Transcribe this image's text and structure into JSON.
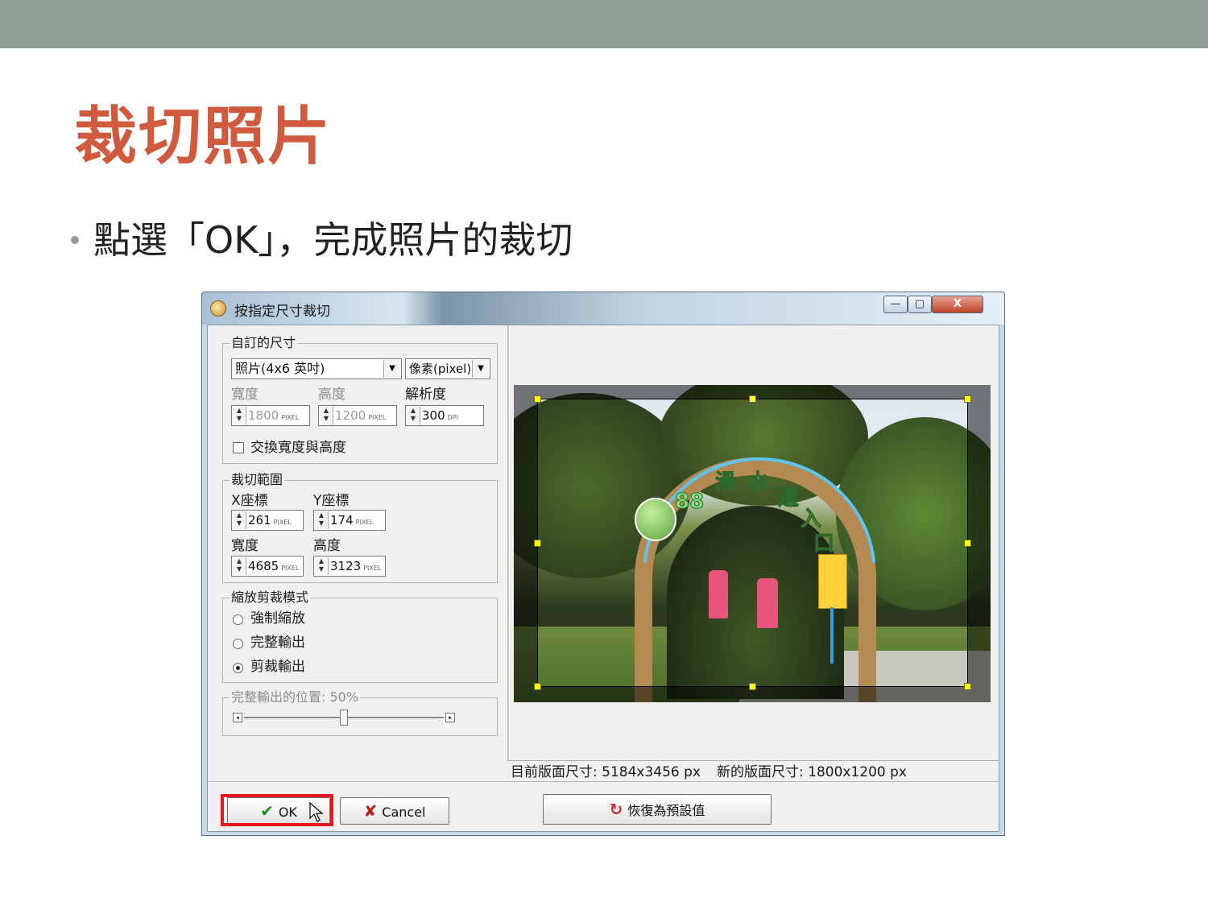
{
  "slide": {
    "title": "裁切照片",
    "bullet": "點選「OK」，完成照片的裁切"
  },
  "window": {
    "title": "按指定尺寸裁切",
    "controls": {
      "minimize": "—",
      "maximize": "▢",
      "close": "X"
    }
  },
  "size_group": {
    "label": "自訂的尺寸",
    "preset": "照片(4x6 英吋)",
    "unit_select": "像素(pixel)",
    "width_label": "寬度",
    "height_label": "高度",
    "resolution_label": "解析度",
    "width_value": "1800",
    "height_value": "1200",
    "resolution_value": "300",
    "pixel_unit": "PIXEL",
    "dpi_unit": "DPI",
    "swap_label": "交換寬度與高度",
    "swap_checked": false
  },
  "crop_group": {
    "label": "裁切範圍",
    "x_label": "X座標",
    "y_label": "Y座標",
    "width_label": "寬度",
    "height_label": "高度",
    "x_value": "261",
    "y_value": "174",
    "width_value": "4685",
    "height_value": "3123",
    "pixel_unit": "PIXEL"
  },
  "mode_group": {
    "label": "縮放剪裁模式",
    "options": [
      "強制縮放",
      "完整輸出",
      "剪裁輸出"
    ],
    "selected_index": 2
  },
  "position_group": {
    "label": "完整輸出的位置: 50%",
    "slider_value": 0.5
  },
  "status": {
    "current_size": "目前版面尺寸: 5184x3456 px",
    "new_size": "新的版面尺寸: 1800x1200 px"
  },
  "buttons": {
    "ok": "OK",
    "cancel": "Cancel",
    "reset": "恢復為預設值"
  },
  "preview": {
    "arch_text": [
      "88",
      "滑",
      "水",
      "道",
      "入",
      "口"
    ]
  },
  "colors": {
    "title_red": "#d05a3e",
    "topbar": "#8fa097",
    "highlight_red": "#e8141f",
    "handle_yellow": "#ffff00"
  },
  "icons": {
    "ok": "checkmark-icon",
    "cancel": "x-icon",
    "reset": "reload-icon",
    "app": "app-icon",
    "cursor": "mouse-cursor-icon"
  }
}
